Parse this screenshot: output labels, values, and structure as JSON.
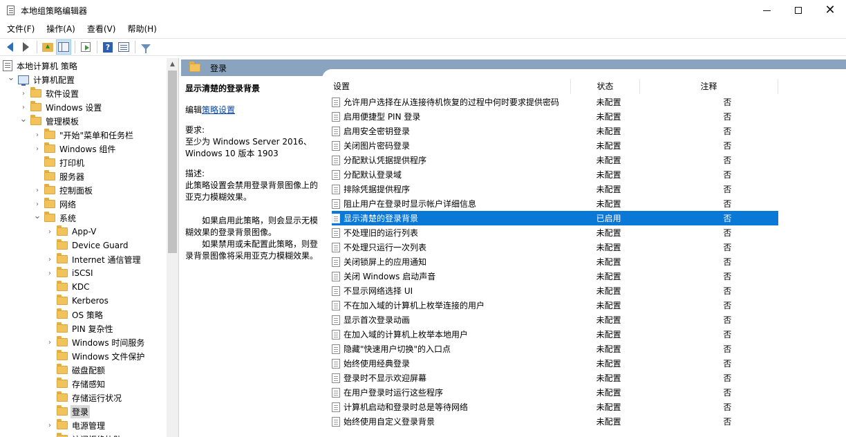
{
  "window": {
    "title": "本地组策略编辑器"
  },
  "menu": [
    "文件(F)",
    "操作(A)",
    "查看(V)",
    "帮助(H)"
  ],
  "tree": {
    "items": [
      {
        "label": "本地计算机 策略",
        "icon": "policy-icon",
        "expander": "none"
      },
      {
        "label": "计算机配置",
        "icon": "computer-icon",
        "expander": "expanded"
      },
      {
        "label": "软件设置",
        "icon": "folder-icon",
        "expander": "collapsed"
      },
      {
        "label": "Windows 设置",
        "icon": "folder-icon",
        "expander": "collapsed"
      },
      {
        "label": "管理模板",
        "icon": "folder-icon",
        "expander": "expanded"
      },
      {
        "label": "\"开始\"菜单和任务栏",
        "icon": "folder-icon",
        "expander": "collapsed"
      },
      {
        "label": "Windows 组件",
        "icon": "folder-icon",
        "expander": "collapsed"
      },
      {
        "label": "打印机",
        "icon": "folder-icon",
        "expander": "none"
      },
      {
        "label": "服务器",
        "icon": "folder-icon",
        "expander": "none"
      },
      {
        "label": "控制面板",
        "icon": "folder-icon",
        "expander": "collapsed"
      },
      {
        "label": "网络",
        "icon": "folder-icon",
        "expander": "collapsed"
      },
      {
        "label": "系统",
        "icon": "folder-icon",
        "expander": "expanded"
      },
      {
        "label": "App-V",
        "icon": "folder-icon",
        "expander": "collapsed"
      },
      {
        "label": "Device Guard",
        "icon": "folder-icon",
        "expander": "none"
      },
      {
        "label": "Internet 通信管理",
        "icon": "folder-icon",
        "expander": "collapsed"
      },
      {
        "label": "iSCSI",
        "icon": "folder-icon",
        "expander": "collapsed"
      },
      {
        "label": "KDC",
        "icon": "folder-icon",
        "expander": "none"
      },
      {
        "label": "Kerberos",
        "icon": "folder-icon",
        "expander": "none"
      },
      {
        "label": "OS 策略",
        "icon": "folder-icon",
        "expander": "none"
      },
      {
        "label": "PIN 复杂性",
        "icon": "folder-icon",
        "expander": "none"
      },
      {
        "label": "Windows 时间服务",
        "icon": "folder-icon",
        "expander": "collapsed"
      },
      {
        "label": "Windows 文件保护",
        "icon": "folder-icon",
        "expander": "none"
      },
      {
        "label": "磁盘配额",
        "icon": "folder-icon",
        "expander": "none"
      },
      {
        "label": "存储感知",
        "icon": "folder-icon",
        "expander": "none"
      },
      {
        "label": "存储运行状况",
        "icon": "folder-icon",
        "expander": "none"
      },
      {
        "label": "登录",
        "icon": "folder-icon",
        "expander": "none",
        "selected": true
      },
      {
        "label": "电源管理",
        "icon": "folder-icon",
        "expander": "collapsed"
      },
      {
        "label": "访问拒绝协助",
        "icon": "folder-icon",
        "expander": "none"
      }
    ]
  },
  "header": {
    "title": "登录"
  },
  "description": {
    "title": "显示清楚的登录背景",
    "edit_prefix": "编辑",
    "edit_link": "策略设置",
    "requirement_label": "要求:",
    "requirement_text": "至少为 Windows Server 2016、Windows 10 版本 1903",
    "description_label": "描述:",
    "description_text": "此策略设置会禁用登录背景图像上的亚克力模糊效果。",
    "para1": "如果启用此策略，则会显示无模糊效果的登录背景图像。",
    "para2": "如果禁用或未配置此策略，则登录背景图像将采用亚克力模糊效果。"
  },
  "columns": {
    "setting": "设置",
    "state": "状态",
    "note": "注释"
  },
  "settings": [
    {
      "name": "允许用户选择在从连接待机恢复的过程中何时要求提供密码",
      "state": "未配置",
      "note": "否"
    },
    {
      "name": "启用便捷型 PIN 登录",
      "state": "未配置",
      "note": "否"
    },
    {
      "name": "启用安全密钥登录",
      "state": "未配置",
      "note": "否"
    },
    {
      "name": "关闭图片密码登录",
      "state": "未配置",
      "note": "否"
    },
    {
      "name": "分配默认凭据提供程序",
      "state": "未配置",
      "note": "否"
    },
    {
      "name": "分配默认登录域",
      "state": "未配置",
      "note": "否"
    },
    {
      "name": "排除凭据提供程序",
      "state": "未配置",
      "note": "否"
    },
    {
      "name": "阻止用户在登录时显示帐户详细信息",
      "state": "未配置",
      "note": "否"
    },
    {
      "name": "显示清楚的登录背景",
      "state": "已启用",
      "note": "否",
      "selected": true
    },
    {
      "name": "不处理旧的运行列表",
      "state": "未配置",
      "note": "否"
    },
    {
      "name": "不处理只运行一次列表",
      "state": "未配置",
      "note": "否"
    },
    {
      "name": "关闭锁屏上的应用通知",
      "state": "未配置",
      "note": "否"
    },
    {
      "name": "关闭 Windows 启动声音",
      "state": "未配置",
      "note": "否"
    },
    {
      "name": "不显示网络选择 UI",
      "state": "未配置",
      "note": "否"
    },
    {
      "name": "不在加入域的计算机上枚举连接的用户",
      "state": "未配置",
      "note": "否"
    },
    {
      "name": "显示首次登录动画",
      "state": "未配置",
      "note": "否"
    },
    {
      "name": "在加入域的计算机上枚举本地用户",
      "state": "未配置",
      "note": "否"
    },
    {
      "name": "隐藏\"快速用户切换\"的入口点",
      "state": "未配置",
      "note": "否"
    },
    {
      "name": "始终使用经典登录",
      "state": "未配置",
      "note": "否"
    },
    {
      "name": "登录时不显示欢迎屏幕",
      "state": "未配置",
      "note": "否"
    },
    {
      "name": "在用户登录时运行这些程序",
      "state": "未配置",
      "note": "否"
    },
    {
      "name": "计算机启动和登录时总是等待网络",
      "state": "未配置",
      "note": "否"
    },
    {
      "name": "始终使用自定义登录背景",
      "state": "未配置",
      "note": "否"
    }
  ],
  "colors": {
    "selection": "#0a78d7",
    "header_band": "#8aa4c0",
    "link": "#0645ad"
  }
}
